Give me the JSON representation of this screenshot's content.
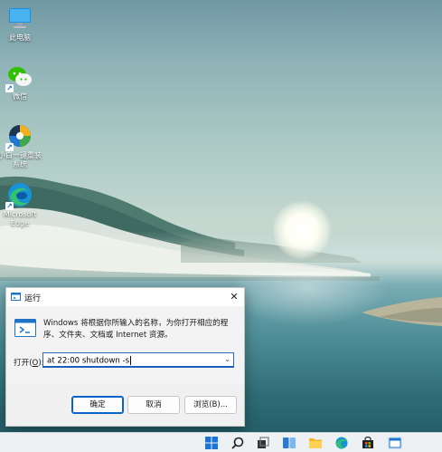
{
  "desktop": {
    "icons": [
      {
        "label": "此电脑",
        "icon": "computer-icon"
      },
      {
        "label": "微信",
        "icon": "wechat-icon"
      },
      {
        "label": "小白一键重装系统",
        "icon": "reinstall-tool-icon"
      },
      {
        "label": "Microsoft Edge",
        "icon": "edge-icon"
      }
    ]
  },
  "run_dialog": {
    "title": "运行",
    "description": "Windows 将根据你所输入的名称，为你打开相应的程序、文件夹、文档或 Internet 资源。",
    "open_label": "打开(",
    "open_accel": "O",
    "open_label_end": "):",
    "command": "at 22:00 shutdown -s",
    "buttons": {
      "ok": "确定",
      "cancel": "取消",
      "browse": "浏览(B)..."
    }
  },
  "taskbar": {
    "items": [
      "start-icon",
      "search-icon",
      "task-view-icon",
      "widgets-icon",
      "file-explorer-icon",
      "edge-icon",
      "store-icon",
      "run-icon"
    ]
  },
  "colors": {
    "accent": "#0a64c8",
    "taskbar": "#eef1f3",
    "dialog": "#f3f3f3"
  }
}
